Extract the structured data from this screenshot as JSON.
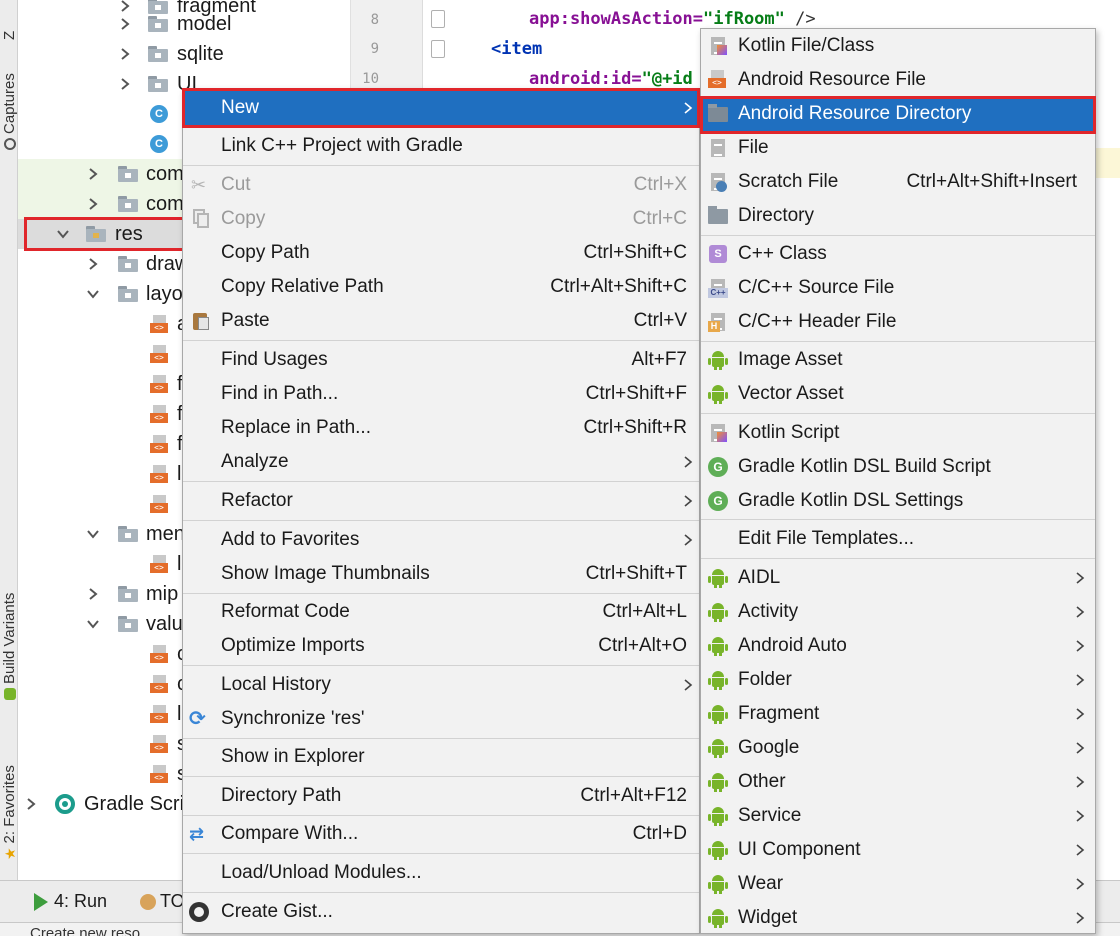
{
  "tool_windows": {
    "captures": "Captures",
    "build_variants": "Build Variants",
    "favorites": "2: Favorites",
    "top_stub": "Z"
  },
  "tree": {
    "items": [
      {
        "label": "fragment",
        "kind": "folder"
      },
      {
        "label": "model",
        "kind": "folder"
      },
      {
        "label": "sqlite",
        "kind": "folder"
      },
      {
        "label": "UI",
        "kind": "folder"
      },
      {
        "label": "",
        "kind": "class"
      },
      {
        "label": "",
        "kind": "class"
      },
      {
        "label": "com",
        "kind": "folder"
      },
      {
        "label": "com",
        "kind": "folder"
      },
      {
        "label": "res",
        "kind": "res-folder"
      },
      {
        "label": "draw",
        "kind": "folder"
      },
      {
        "label": "layo",
        "kind": "folder"
      },
      {
        "label": "a",
        "kind": "xml"
      },
      {
        "label": "",
        "kind": "xml"
      },
      {
        "label": "f",
        "kind": "xml"
      },
      {
        "label": "f",
        "kind": "xml"
      },
      {
        "label": "f",
        "kind": "xml"
      },
      {
        "label": "l",
        "kind": "xml"
      },
      {
        "label": "",
        "kind": "xml"
      },
      {
        "label": "men",
        "kind": "folder"
      },
      {
        "label": "l",
        "kind": "xml"
      },
      {
        "label": "mip",
        "kind": "folder"
      },
      {
        "label": "valu",
        "kind": "folder"
      },
      {
        "label": "c",
        "kind": "xml"
      },
      {
        "label": "c",
        "kind": "xml"
      },
      {
        "label": "l",
        "kind": "xml"
      },
      {
        "label": "s",
        "kind": "xml"
      },
      {
        "label": "s",
        "kind": "xml"
      },
      {
        "label": "Gradle Scri",
        "kind": "gradle"
      }
    ]
  },
  "editor": {
    "line_numbers": [
      "8",
      "9",
      "10"
    ],
    "line8": {
      "attr": "app:showAsAction=",
      "value": "\"ifRoom\"",
      "tail": " />"
    },
    "line9": {
      "tag": "<item"
    },
    "line10": {
      "attr": "android:id=",
      "value": "\"@+id"
    }
  },
  "context_menu": {
    "items": [
      {
        "label": "New",
        "shortcut": ""
      },
      {
        "label": "Link C++ Project with Gradle",
        "shortcut": ""
      },
      {
        "label": "Cut",
        "shortcut": "Ctrl+X"
      },
      {
        "label": "Copy",
        "shortcut": "Ctrl+C"
      },
      {
        "label": "Copy Path",
        "shortcut": "Ctrl+Shift+C"
      },
      {
        "label": "Copy Relative Path",
        "shortcut": "Ctrl+Alt+Shift+C"
      },
      {
        "label": "Paste",
        "shortcut": "Ctrl+V"
      },
      {
        "label": "Find Usages",
        "shortcut": "Alt+F7"
      },
      {
        "label": "Find in Path...",
        "shortcut": "Ctrl+Shift+F"
      },
      {
        "label": "Replace in Path...",
        "shortcut": "Ctrl+Shift+R"
      },
      {
        "label": "Analyze",
        "shortcut": ""
      },
      {
        "label": "Refactor",
        "shortcut": ""
      },
      {
        "label": "Add to Favorites",
        "shortcut": ""
      },
      {
        "label": "Show Image Thumbnails",
        "shortcut": "Ctrl+Shift+T"
      },
      {
        "label": "Reformat Code",
        "shortcut": "Ctrl+Alt+L"
      },
      {
        "label": "Optimize Imports",
        "shortcut": "Ctrl+Alt+O"
      },
      {
        "label": "Local History",
        "shortcut": ""
      },
      {
        "label": "Synchronize 'res'",
        "shortcut": ""
      },
      {
        "label": "Show in Explorer",
        "shortcut": ""
      },
      {
        "label": "Directory Path",
        "shortcut": "Ctrl+Alt+F12"
      },
      {
        "label": "Compare With...",
        "shortcut": "Ctrl+D"
      },
      {
        "label": "Load/Unload Modules...",
        "shortcut": ""
      },
      {
        "label": "Create Gist...",
        "shortcut": ""
      }
    ]
  },
  "new_submenu": {
    "items": [
      {
        "label": "Kotlin File/Class",
        "shortcut": ""
      },
      {
        "label": "Android Resource File",
        "shortcut": ""
      },
      {
        "label": "Android Resource Directory",
        "shortcut": ""
      },
      {
        "label": "File",
        "shortcut": ""
      },
      {
        "label": "Scratch File",
        "shortcut": "Ctrl+Alt+Shift+Insert"
      },
      {
        "label": "Directory",
        "shortcut": ""
      },
      {
        "label": "C++ Class",
        "shortcut": ""
      },
      {
        "label": "C/C++ Source File",
        "shortcut": ""
      },
      {
        "label": "C/C++ Header File",
        "shortcut": ""
      },
      {
        "label": "Image Asset",
        "shortcut": ""
      },
      {
        "label": "Vector Asset",
        "shortcut": ""
      },
      {
        "label": "Kotlin Script",
        "shortcut": ""
      },
      {
        "label": "Gradle Kotlin DSL Build Script",
        "shortcut": ""
      },
      {
        "label": "Gradle Kotlin DSL Settings",
        "shortcut": ""
      },
      {
        "label": "Edit File Templates...",
        "shortcut": ""
      },
      {
        "label": "AIDL",
        "shortcut": ""
      },
      {
        "label": "Activity",
        "shortcut": ""
      },
      {
        "label": "Android Auto",
        "shortcut": ""
      },
      {
        "label": "Folder",
        "shortcut": ""
      },
      {
        "label": "Fragment",
        "shortcut": ""
      },
      {
        "label": "Google",
        "shortcut": ""
      },
      {
        "label": "Other",
        "shortcut": ""
      },
      {
        "label": "Service",
        "shortcut": ""
      },
      {
        "label": "UI Component",
        "shortcut": ""
      },
      {
        "label": "Wear",
        "shortcut": ""
      },
      {
        "label": "Widget",
        "shortcut": ""
      }
    ]
  },
  "bottom_bar": {
    "run": "4: Run",
    "todo": "TO",
    "status": "Create new reso"
  },
  "colors": {
    "accent": "#1f6fc0",
    "highlight_box": "#e0262b",
    "android_green": "#78b42a"
  }
}
